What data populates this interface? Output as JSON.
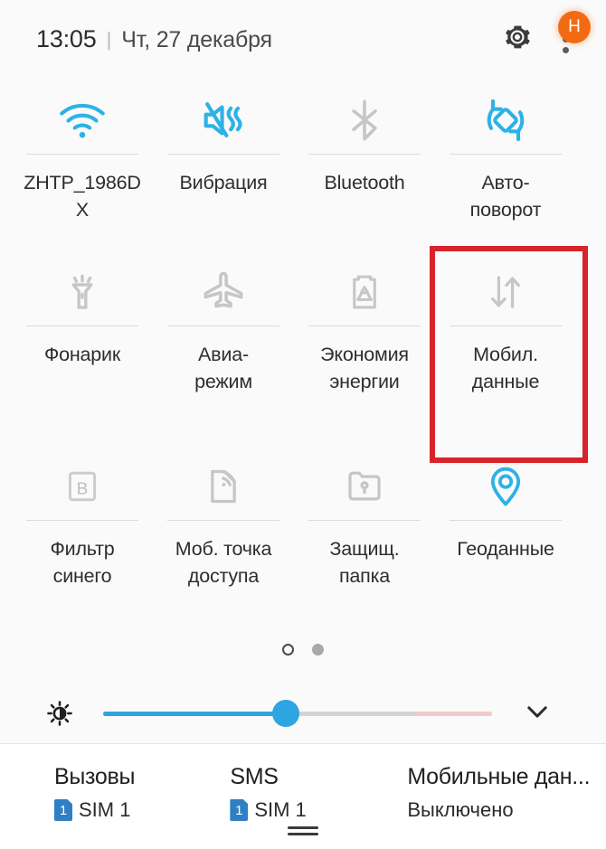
{
  "header": {
    "time": "13:05",
    "separator": "|",
    "date": "Чт, 27 декабря",
    "settings_icon": "gear-icon",
    "overflow_icon": "kebab-menu-icon",
    "avatar_initial": "H",
    "avatar_color": "#f26b12"
  },
  "theme": {
    "background": "#fafafa",
    "accent_on": "#2db2e6",
    "icon_off": "#c8c8c8",
    "label_color": "#2d2d2d",
    "annotation_color": "#d8232a"
  },
  "tiles": [
    {
      "label": "ZHTP_1986D\nX",
      "icon": "wifi-icon",
      "state": "on"
    },
    {
      "label": "Вибрация",
      "icon": "vibrate-icon",
      "state": "on"
    },
    {
      "label": "Bluetooth",
      "icon": "bluetooth-icon",
      "state": "off"
    },
    {
      "label": "Авто-\nповорот",
      "icon": "auto-rotate-icon",
      "state": "on"
    },
    {
      "label": "Фонарик",
      "icon": "flashlight-icon",
      "state": "off"
    },
    {
      "label": "Авиа-\nрежим",
      "icon": "airplane-icon",
      "state": "off"
    },
    {
      "label": "Экономия\nэнергии",
      "icon": "power-saving-icon",
      "state": "off"
    },
    {
      "label": "Мобил.\nданные",
      "icon": "mobile-data-icon",
      "state": "off",
      "highlighted": true
    },
    {
      "label": "Фильтр\nсинего",
      "icon": "blue-light-filter-icon",
      "state": "off"
    },
    {
      "label": "Моб. точка\nдоступа",
      "icon": "hotspot-icon",
      "state": "off"
    },
    {
      "label": "Защищ.\nпапка",
      "icon": "secure-folder-icon",
      "state": "off"
    },
    {
      "label": "Геоданные",
      "icon": "location-pin-icon",
      "state": "on"
    }
  ],
  "pager": {
    "total_pages": 2,
    "current_page": 1
  },
  "brightness": {
    "icon": "brightness-icon",
    "value_percent": 47,
    "expand_icon": "chevron-down-icon"
  },
  "bottom_bar": {
    "columns": [
      {
        "title": "Вызовы",
        "badge": "1",
        "value": "SIM 1"
      },
      {
        "title": "SMS",
        "badge": "1",
        "value": "SIM 1"
      },
      {
        "title": "Мобильные дан...",
        "value": "Выключено"
      }
    ],
    "home_handle": "home-indicator"
  }
}
